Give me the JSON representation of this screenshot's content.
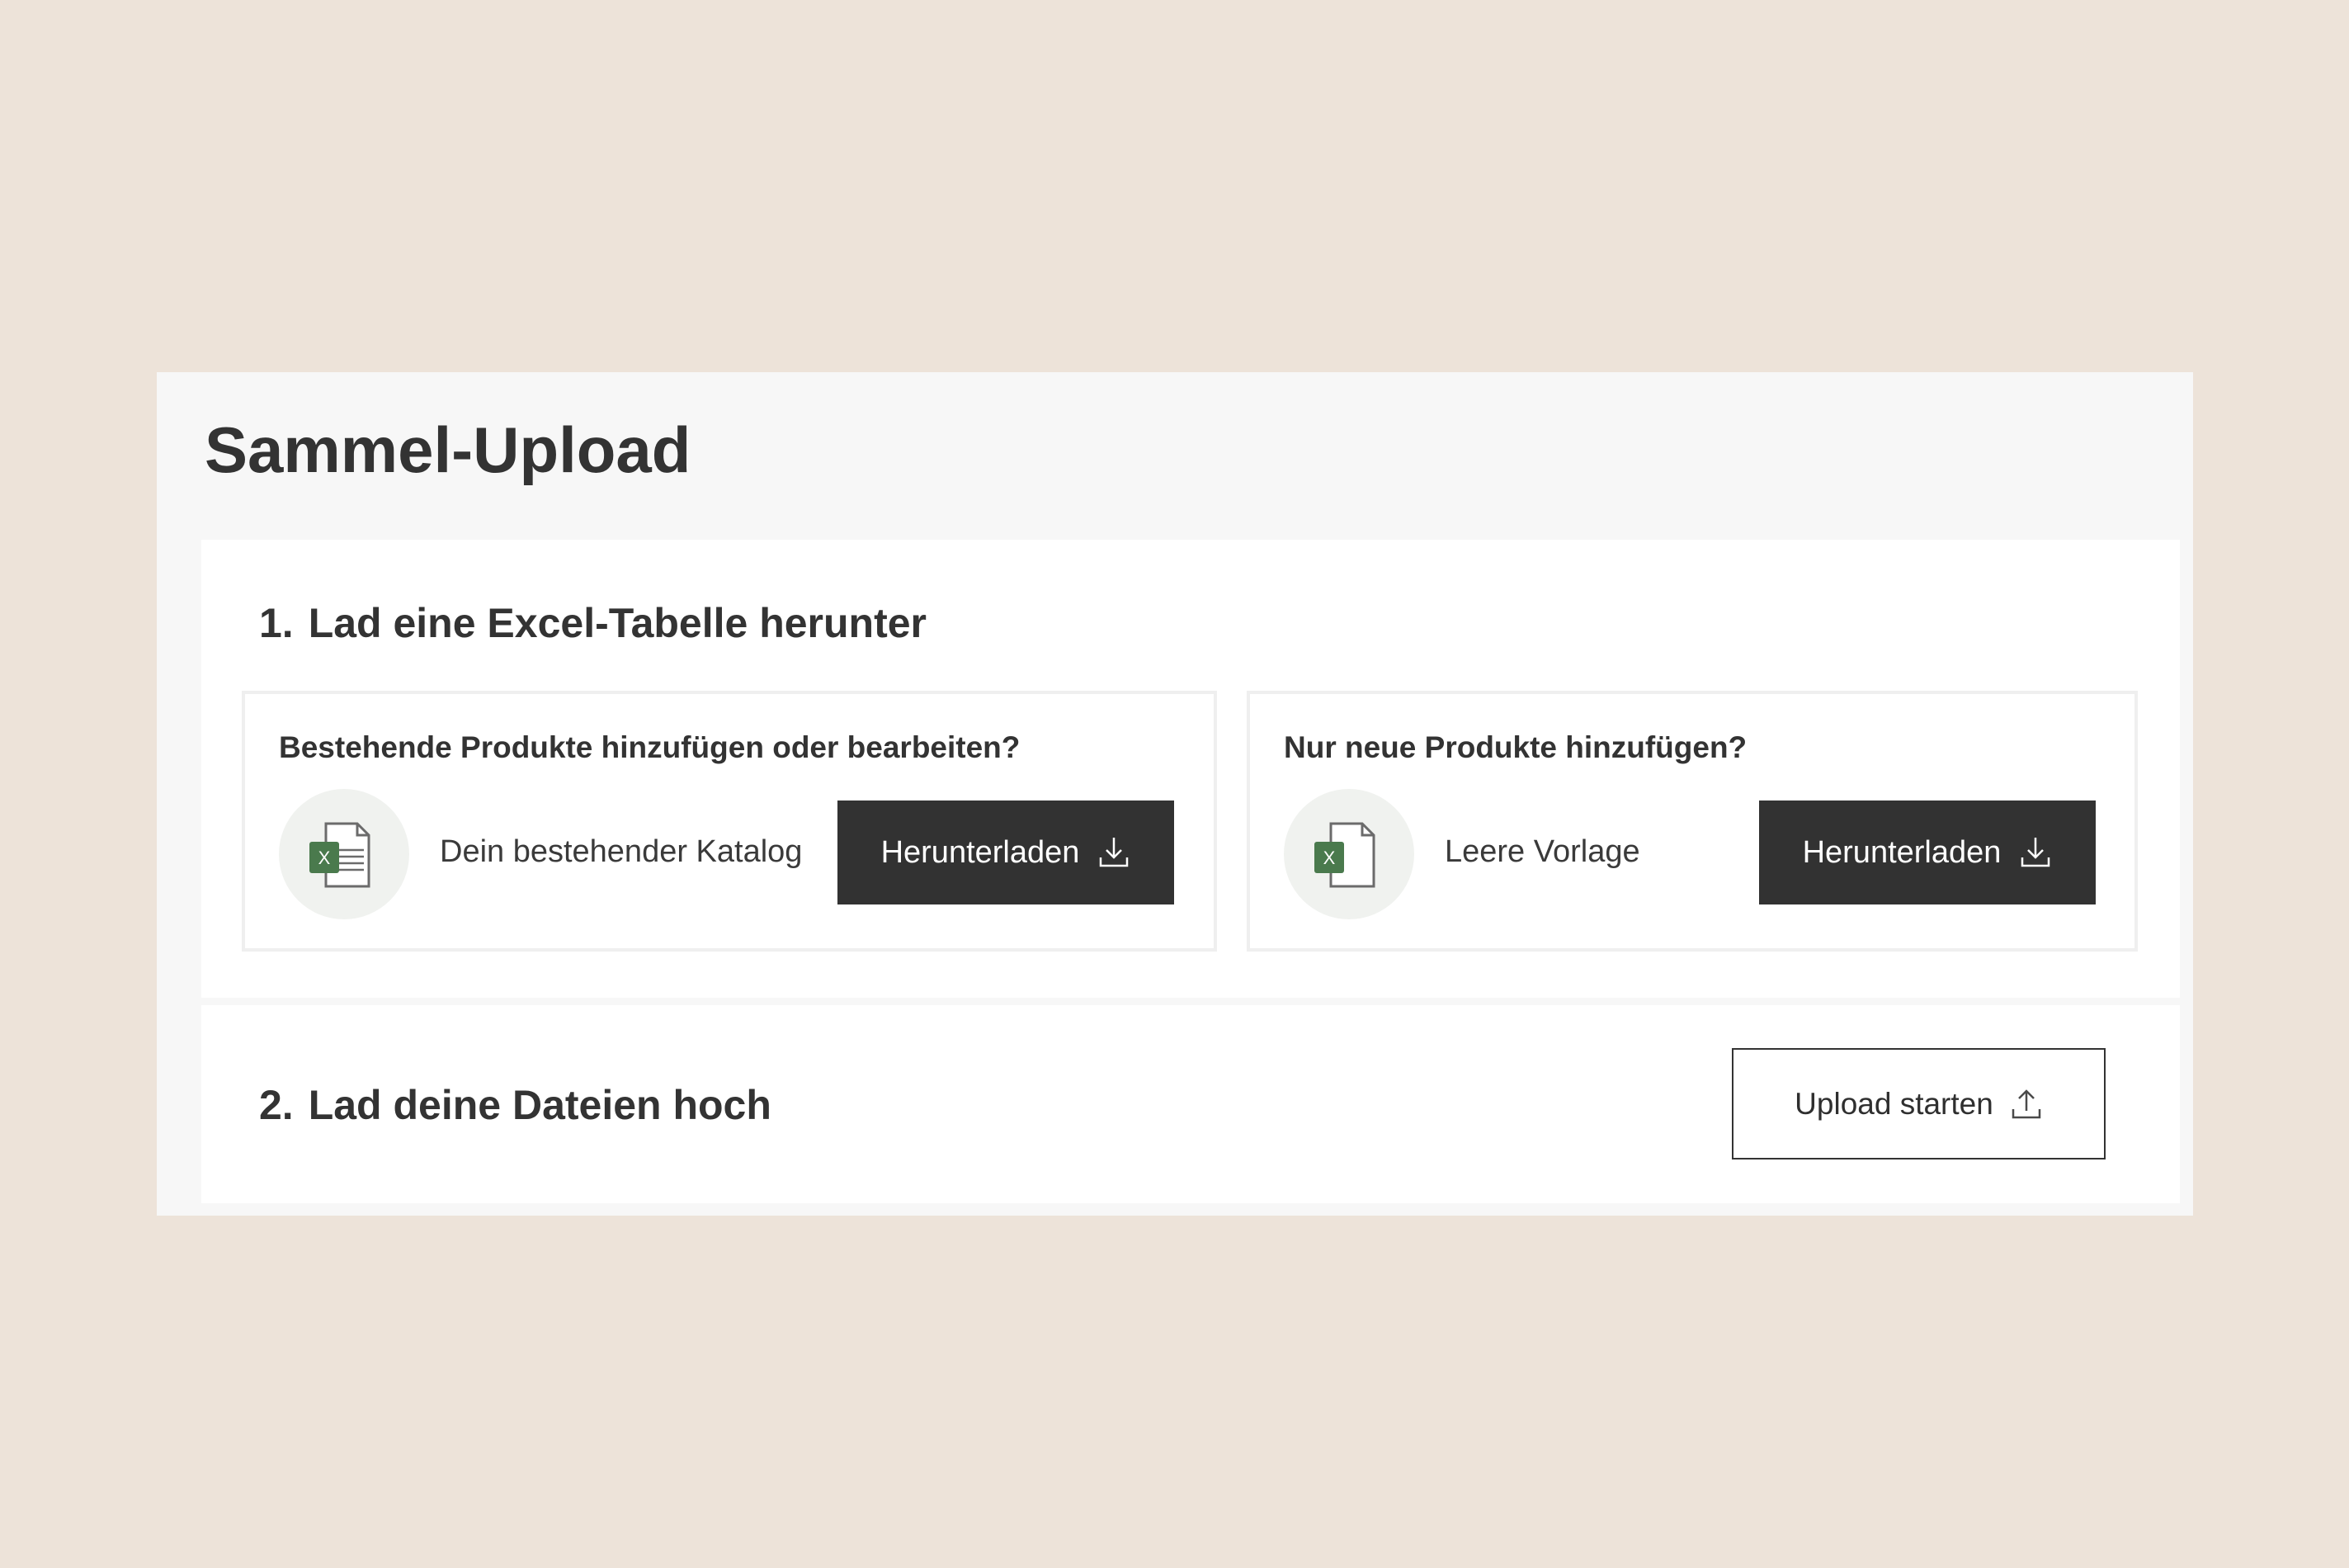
{
  "page": {
    "title": "Sammel-Upload"
  },
  "step1": {
    "number": "1.",
    "heading": "Lad eine Excel-Tabelle herunter",
    "cards": [
      {
        "title": "Bestehende Produkte hinzufügen oder bearbeiten?",
        "file_label": "Dein bestehender Katalog",
        "button_label": "Herunterladen",
        "file_icon": "excel-file-with-lines-icon"
      },
      {
        "title": "Nur neue Produkte hinzufügen?",
        "file_label": "Leere Vorlage",
        "button_label": "Herunterladen",
        "file_icon": "excel-blank-file-icon"
      }
    ]
  },
  "step2": {
    "number": "2.",
    "heading": "Lad deine Dateien hoch",
    "button_label": "Upload starten",
    "button_icon": "upload-icon"
  },
  "colors": {
    "page_background": "#ede3d9",
    "panel_background": "#f7f7f7",
    "button_dark": "#323232",
    "excel_green": "#4a7a4d"
  }
}
